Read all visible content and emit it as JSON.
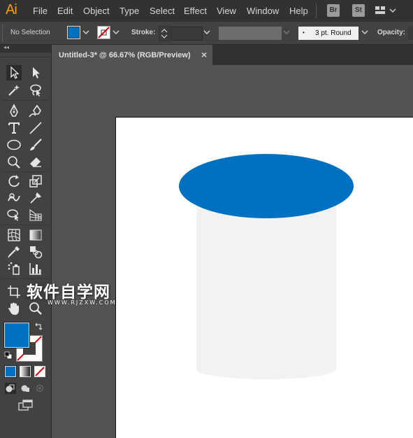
{
  "app": {
    "logo": "Ai"
  },
  "menu": [
    "File",
    "Edit",
    "Object",
    "Type",
    "Select",
    "Effect",
    "View",
    "Window",
    "Help"
  ],
  "bridge_buttons": {
    "br": "Br",
    "st": "St"
  },
  "control_bar": {
    "selection_label": "No Selection",
    "stroke_label": "Stroke:",
    "brush_value": "3 pt. Round",
    "opacity_label": "Opacity:",
    "fill_color": "#0070c0"
  },
  "document_tab": {
    "title": "Untitled-3* @ 66.67% (RGB/Preview)",
    "close": "×"
  },
  "tools": {
    "collapse": "◂◂",
    "fill_color": "#0070c0",
    "stroke_color": "none"
  },
  "artwork": {
    "ellipse_color": "#0070c0",
    "cylinder_color": "#f2f2f2"
  },
  "watermark": {
    "text": "软件自学网",
    "sub": "WWW.RJZXW.COM"
  }
}
